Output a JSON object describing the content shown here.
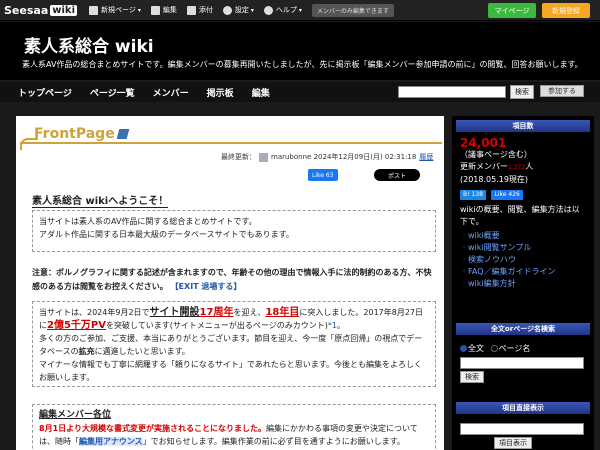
{
  "topbar": {
    "logo": "Seesaa",
    "logo_wiki": "wiki",
    "menu": [
      {
        "label": "新規ページ",
        "caret": "▾"
      },
      {
        "label": "編集",
        "caret": ""
      },
      {
        "label": "添付",
        "caret": ""
      },
      {
        "label": "設定",
        "caret": "▾"
      },
      {
        "label": "ヘルプ",
        "caret": "▾"
      }
    ],
    "member_only": "メンバーのみ編集できます",
    "mypage": "マイページ",
    "register": "新規登録"
  },
  "header": {
    "title": "素人系総合 wiki",
    "description": "素人系AV作品の総合まとめサイトです。編集メンバーの募集再開いたしましたが、先に掲示板「編集メンバー参加申請の前に」の閲覧、回答お願いします。"
  },
  "nav": {
    "items": [
      "トップページ",
      "ページ一覧",
      "メンバー",
      "掲示板",
      "編集"
    ],
    "search_button": "検索",
    "watch_button": "参加する"
  },
  "main": {
    "page_title": "FrontPage",
    "updated_label": "最終更新：",
    "updated_user": "marubonne",
    "updated_date": "2024年12月09日(月) 02:31:18",
    "history": "履歴",
    "fb_like": "Like 63",
    "x_post": "ポスト",
    "welcome": "素人系総合 wikiへようこそ！",
    "box1_line1": "当サイトは素人系のAV作品に関する総合まとめサイトです。",
    "box1_line2": "アダルト作品に関する日本最大級のデータベースサイトでもあります。",
    "notice": "注意：ポルノグラフィに関する記述が含まれますので、年齢その他の理由で情報入手に法的制約のある方、不快感のある方は閲覧をお控えください。",
    "notice_link": "【EXIT 退場する】",
    "box2": {
      "p1": "当サイトは、2024年9月2日で",
      "p2": "サイト開設",
      "p3": "17周年",
      "p4": "を迎え、",
      "p5": "18年目",
      "p6": "に突入しました。2017年8月27日に",
      "p7": "2億5千万PV",
      "p8": "を突破しています(サイトメニューが出るページのみカウント)",
      "p8b": "*1",
      "p8c": "。",
      "p9": "多くの方のご参加、ご支援、本当にありがとうございます。節目を迎え、今一度「原点回帰」の視点でデータベースの",
      "p10": "拡充",
      "p11": "に邁進したいと思います。",
      "p12": "マイナーな情報でも丁寧に網羅する「頼りになるサイト」であれたらと思います。今後とも編集をよろしくお願いします。"
    },
    "box3": {
      "heading": "編集メンバー各位",
      "red": "8月1日より大規模な書式変更が実施されることになりました。",
      "t1": "編集にかかわる事項の変更や決定については、随時「",
      "link": "編集用アナウンス",
      "t2": "」でお知らせします。編集作業の前に必ず目を通すようにお願いします。"
    }
  },
  "sidebar": {
    "count_head": "項目数",
    "count": "24,001",
    "count_note": "（議事ページ含む）",
    "members_label": "更新メンバー",
    "members_count": "1,372",
    "members_unit": "人",
    "since": "(2018.05.19現在)",
    "hb_label": "B!",
    "hb_count": "138",
    "fb_like": "Like 426",
    "intro": "wikiの概要、閲覧、編集方法は以下で。",
    "links": [
      "wiki概要",
      "wiki閲覧サンプル",
      "検索ノウハウ",
      "FAQ／編集ガイドライン",
      "wiki編集方針"
    ],
    "search_head": "全文orページ名検索",
    "radio_full": "全文",
    "radio_page": "ページ名",
    "search_button": "検索",
    "direct_head": "項目直接表示",
    "direct_button": "項目表示"
  }
}
